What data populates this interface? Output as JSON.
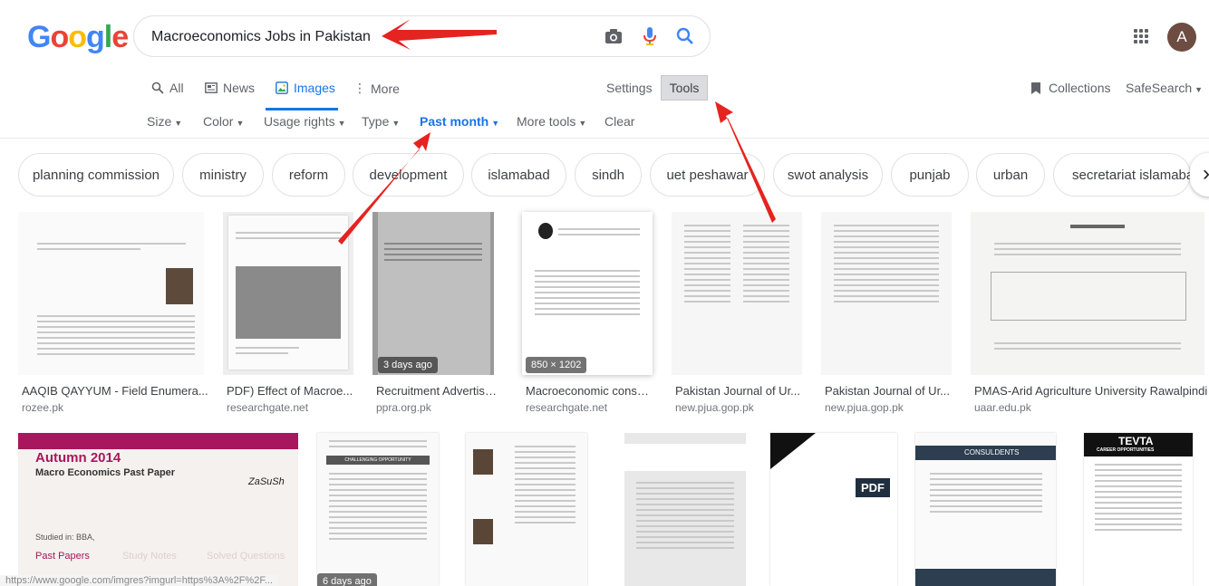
{
  "logo": [
    "G",
    "o",
    "o",
    "g",
    "l",
    "e"
  ],
  "logo_colors": [
    "#4285F4",
    "#EA4335",
    "#FBBC05",
    "#4285F4",
    "#34A853",
    "#EA4335"
  ],
  "search": {
    "query": "Macroeconomics Jobs in Pakistan"
  },
  "user": {
    "avatar_letter": "A"
  },
  "tabs": {
    "all": "All",
    "news": "News",
    "images": "Images",
    "more": "More"
  },
  "settings_label": "Settings",
  "tools_label": "Tools",
  "collections_label": "Collections",
  "safesearch_label": "SafeSearch",
  "tools": {
    "size": "Size",
    "color": "Color",
    "usage": "Usage rights",
    "type": "Type",
    "time": "Past month",
    "more": "More tools",
    "clear": "Clear"
  },
  "chips": [
    "planning commission",
    "ministry",
    "reform",
    "development",
    "islamabad",
    "sindh",
    "uet peshawar",
    "swot analysis",
    "punjab",
    "urban",
    "secretariat islamabad"
  ],
  "results": [
    {
      "title": "AAQIB QAYYUM - Field Enumera...",
      "source": "rozee.pk"
    },
    {
      "title": "PDF) Effect of Macroe...",
      "source": "researchgate.net"
    },
    {
      "title": "Recruitment Advertise...",
      "source": "ppra.org.pk",
      "badge": "3 days ago"
    },
    {
      "title": "Macroeconomic conse...",
      "source": "researchgate.net",
      "badge": "850 × 1202"
    },
    {
      "title": "Pakistan Journal of Ur...",
      "source": "new.pjua.gop.pk"
    },
    {
      "title": "Pakistan Journal of Ur...",
      "source": "new.pjua.gop.pk"
    },
    {
      "title": "PMAS-Arid Agriculture University Rawalpindi",
      "source": "uaar.edu.pk"
    }
  ],
  "row2": {
    "autumn_title": "Autumn 2014",
    "autumn_subtitle": "Macro Economics Past Paper",
    "autumn_brand": "ZaSuSh",
    "studied": "Studied in: BBA,",
    "past_papers": "Past Papers",
    "study_notes": "Study Notes",
    "solved": "Solved Questions",
    "challenging": "CHALLENGING OPPORTUNITY",
    "pdf_label": "PDF",
    "consultants": "CONSULDENTS",
    "tevta": "TEVTA",
    "career": "CAREER OPPORTUNITIES",
    "age_badge": "6 days ago"
  },
  "status_url": "https://www.google.com/imgres?imgurl=https%3A%2F%2F..."
}
